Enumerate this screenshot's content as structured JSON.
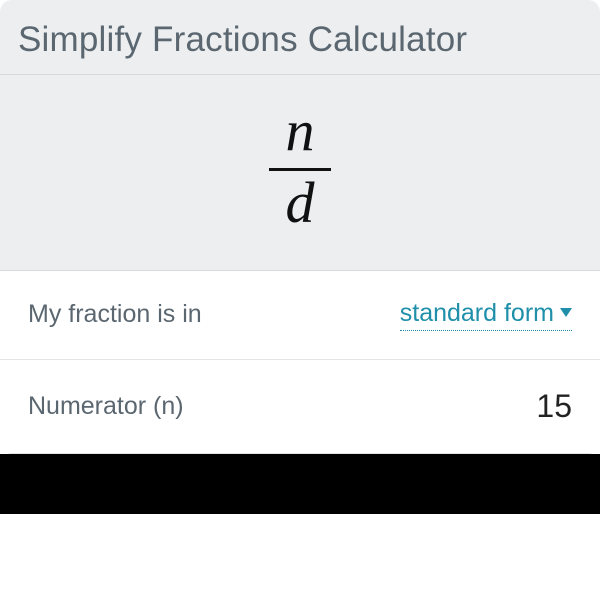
{
  "title": "Simplify Fractions Calculator",
  "fraction_display": {
    "numerator_symbol": "n",
    "denominator_symbol": "d"
  },
  "rows": {
    "form_selector": {
      "label": "My fraction is in",
      "value": "standard form"
    },
    "numerator": {
      "label": "Numerator (n)",
      "value": "15"
    }
  }
}
